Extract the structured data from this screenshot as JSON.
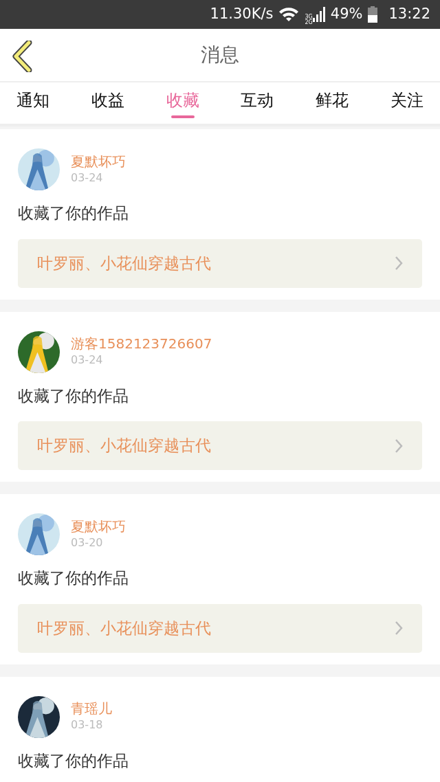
{
  "status_bar": {
    "speed": "11.30K/s",
    "network_labels": [
      "3G",
      "2G"
    ],
    "battery": "49%",
    "time": "13:22"
  },
  "header": {
    "title": "消息"
  },
  "tabs": [
    {
      "label": "通知",
      "selected": false
    },
    {
      "label": "收益",
      "selected": false
    },
    {
      "label": "收藏",
      "selected": true
    },
    {
      "label": "互动",
      "selected": false
    },
    {
      "label": "鲜花",
      "selected": false
    },
    {
      "label": "关注",
      "selected": false
    }
  ],
  "messages": [
    {
      "user": "夏默坏巧",
      "date": "03-24",
      "text": "收藏了你的作品",
      "work": "叶罗丽、小花仙穿越古代"
    },
    {
      "user": "游客1582123726607",
      "date": "03-24",
      "text": "收藏了你的作品",
      "work": "叶罗丽、小花仙穿越古代"
    },
    {
      "user": "夏默坏巧",
      "date": "03-20",
      "text": "收藏了你的作品",
      "work": "叶罗丽、小花仙穿越古代"
    },
    {
      "user": "青瑶儿",
      "date": "03-18",
      "text": "收藏了你的作品"
    }
  ]
}
